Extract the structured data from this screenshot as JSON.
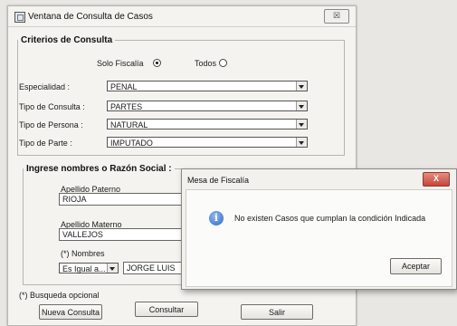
{
  "window": {
    "title": "Ventana de Consulta de Casos",
    "close_glyph": "☒"
  },
  "criteria": {
    "legend": "Criterios de Consulta",
    "radio_solo_label": "Solo Fiscalía",
    "radio_todos_label": "Todos",
    "selected": "solo",
    "especialidad_label": "Especialidad :",
    "especialidad_value": "PENAL",
    "tipo_consulta_label": "Tipo de Consulta :",
    "tipo_consulta_value": "PARTES",
    "tipo_persona_label": "Tipo de Persona :",
    "tipo_persona_value": "NATURAL",
    "tipo_parte_label": "Tipo de Parte :",
    "tipo_parte_value": "IMPUTADO"
  },
  "names": {
    "legend": "Ingrese nombres o Razón Social :",
    "apellido_paterno_label": "Apellido Paterno",
    "apellido_paterno_value": "RIOJA",
    "apellido_materno_label": "Apellido Materno",
    "apellido_materno_value": "VALLEJOS",
    "nombres_label": "(*) Nombres",
    "match_value": "Es Igual a...",
    "nombres_value": "JORGE LUIS"
  },
  "footer": {
    "note": "(*) Busqueda opcional",
    "nueva_label": "Nueva Consulta",
    "consultar_label": "Consultar",
    "salir_label": "Salir"
  },
  "dialog": {
    "title": "Mesa de Fiscalía",
    "close_glyph": "X",
    "message": "No existen Casos que cumplan la condición Indicada",
    "ok_label": "Aceptar"
  },
  "colors": {
    "dialog_close": "#c6463a",
    "info_icon": "#2d68c4"
  }
}
